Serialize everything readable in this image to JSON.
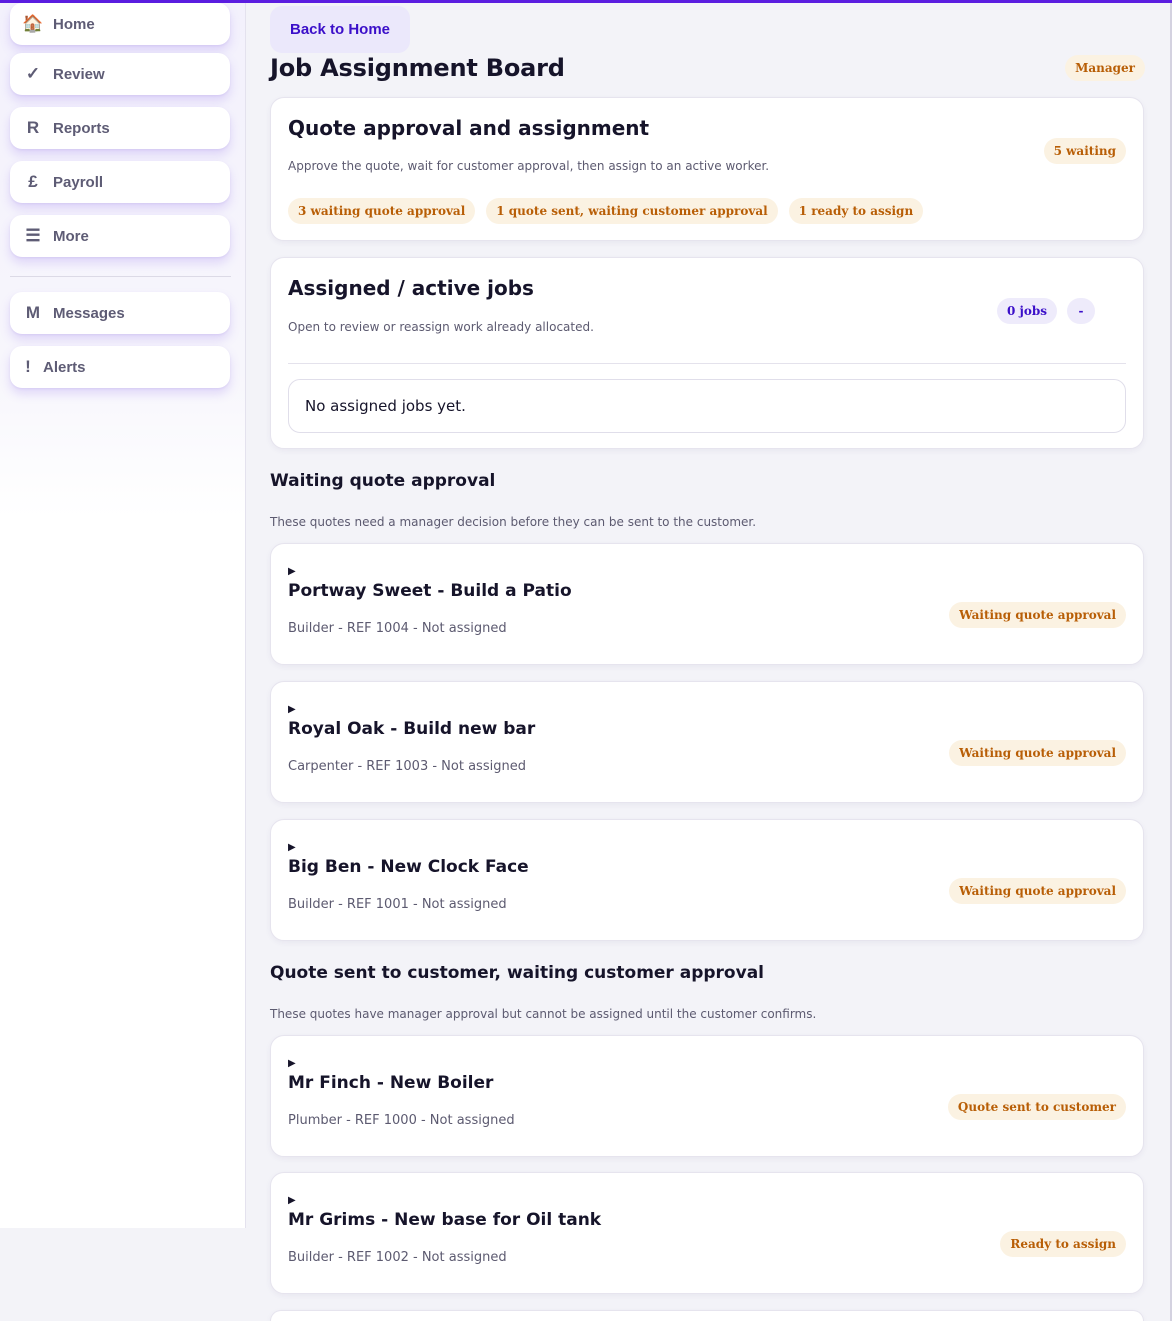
{
  "sidebar": {
    "items": [
      {
        "label": "Home",
        "icon": "🏠",
        "icon_name": "home-icon"
      },
      {
        "label": "Review",
        "icon": "✓",
        "icon_name": "check-icon"
      },
      {
        "label": "Reports",
        "icon": "R",
        "icon_name": "reports-icon"
      },
      {
        "label": "Payroll",
        "icon": "£",
        "icon_name": "pound-icon"
      },
      {
        "label": "More",
        "icon": "☰",
        "icon_name": "menu-icon"
      }
    ],
    "secondary_items": [
      {
        "label": "Messages",
        "icon": "M",
        "icon_name": "messages-icon"
      },
      {
        "label": "Alerts",
        "icon": "!",
        "icon_name": "alert-icon"
      }
    ]
  },
  "header": {
    "back_label": "Back to Home",
    "title": "Job Assignment Board",
    "role_badge": "Manager"
  },
  "quote_card": {
    "title": "Quote approval and assignment",
    "description": "Approve the quote, wait for customer approval, then assign to an active worker.",
    "waiting_badge": "5 waiting",
    "chips": [
      "3 waiting quote approval",
      "1 quote sent, waiting customer approval",
      "1 ready to assign"
    ]
  },
  "assigned_card": {
    "title": "Assigned / active jobs",
    "description": "Open to review or reassign work already allocated.",
    "jobs_badge": "0 jobs",
    "dash_badge": "-",
    "empty_text": "No assigned jobs yet."
  },
  "sections": [
    {
      "title": "Waiting quote approval",
      "description": "These quotes need a manager decision before they can be sent to the customer.",
      "jobs": [
        {
          "title": "Portway Sweet - Build a Patio",
          "meta": "Builder - REF 1004 - Not assigned",
          "status": "Waiting quote approval"
        },
        {
          "title": "Royal Oak - Build new bar",
          "meta": "Carpenter - REF 1003 - Not assigned",
          "status": "Waiting quote approval"
        },
        {
          "title": "Big Ben - New Clock Face",
          "meta": "Builder - REF 1001 - Not assigned",
          "status": "Waiting quote approval"
        }
      ]
    },
    {
      "title": "Quote sent to customer, waiting customer approval",
      "description": "These quotes have manager approval but cannot be assigned until the customer confirms.",
      "jobs": [
        {
          "title": "Mr Finch - New Boiler",
          "meta": "Plumber - REF 1000 - Not assigned",
          "status": "Quote sent to customer"
        },
        {
          "title": "Mr Grims - New base for Oil tank",
          "meta": "Builder - REF 1002 - Not assigned",
          "status": "Ready to assign"
        }
      ]
    }
  ],
  "colors": {
    "accent": "#3b0fc9",
    "top_bar": "#5b1de0",
    "badge_bg": "#fbf2e2",
    "badge_text": "#b85e06",
    "purple_badge_bg": "#eeebfb"
  }
}
